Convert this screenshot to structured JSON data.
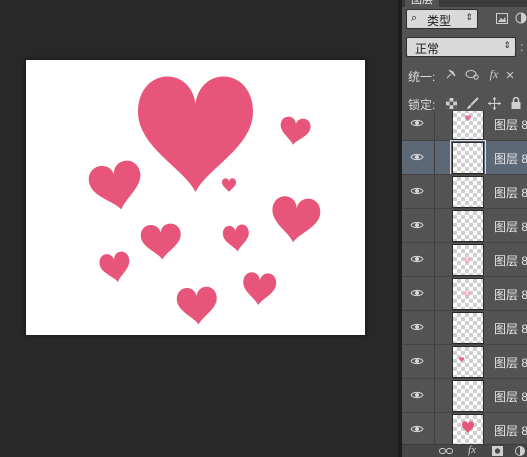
{
  "colors": {
    "workspace": "#282828",
    "panel": "#535353",
    "selected_row": "#5d6877",
    "heart": "#e8557a",
    "heart_light": "#f3a0b6"
  },
  "panel": {
    "tab_label": "图层",
    "filter": {
      "icon": "search-icon",
      "value": "类型"
    },
    "blend_mode": "正常",
    "unify_label": "统一:",
    "lock_label": "锁定:",
    "fx_label": "fx"
  },
  "layers": [
    {
      "name": "图层 8",
      "visible": true,
      "selected": false,
      "thumb": "small-heart-top"
    },
    {
      "name": "图层 8",
      "visible": true,
      "selected": true,
      "thumb": "empty"
    },
    {
      "name": "图层 8",
      "visible": true,
      "selected": false,
      "thumb": "empty"
    },
    {
      "name": "图层 8",
      "visible": true,
      "selected": false,
      "thumb": "empty"
    },
    {
      "name": "图层 8",
      "visible": true,
      "selected": false,
      "thumb": "faint-heart"
    },
    {
      "name": "图层 8",
      "visible": true,
      "selected": false,
      "thumb": "faint-heart"
    },
    {
      "name": "图层 8",
      "visible": true,
      "selected": false,
      "thumb": "empty"
    },
    {
      "name": "图层 8",
      "visible": true,
      "selected": false,
      "thumb": "tiny-heart"
    },
    {
      "name": "图层 8",
      "visible": true,
      "selected": false,
      "thumb": "empty"
    },
    {
      "name": "图层 8",
      "visible": true,
      "selected": false,
      "thumb": "heart"
    }
  ],
  "bottom_bar": {
    "fx_label": "fx"
  }
}
